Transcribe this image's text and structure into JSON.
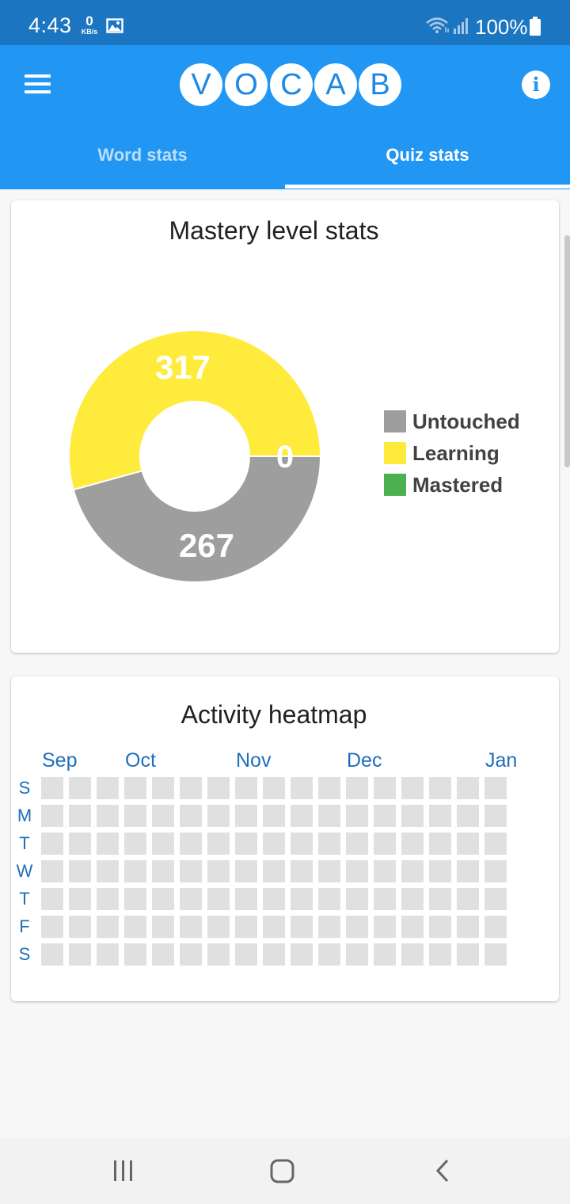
{
  "status_bar": {
    "time": "4:43",
    "net_speed_value": "0",
    "net_speed_unit": "KB/s",
    "battery_percent": "100%",
    "icons": [
      "image-icon",
      "wifi-icon",
      "signal-icon",
      "battery-icon"
    ]
  },
  "app_bar": {
    "logo_letters": [
      "V",
      "O",
      "C",
      "A",
      "B"
    ],
    "menu_icon": "hamburger-menu-icon",
    "info_icon": "info-icon",
    "info_label": "i",
    "colors": {
      "primary": "#2196f3",
      "status_bar": "#1b75c0",
      "logo_text": "#1e88e5"
    }
  },
  "tabs": [
    {
      "label": "Word stats",
      "selected": false
    },
    {
      "label": "Quiz stats",
      "selected": true
    }
  ],
  "mastery": {
    "title": "Mastery level stats",
    "chart_data": {
      "type": "pie",
      "donut": true,
      "categories": [
        "Untouched",
        "Learning",
        "Mastered"
      ],
      "values": [
        267,
        317,
        0
      ],
      "colors": [
        "#9e9e9e",
        "#ffeb3b",
        "#4caf50"
      ],
      "legend_position": "right"
    },
    "labels": {
      "untouched": "267",
      "learning": "317",
      "mastered": "0"
    },
    "legend": [
      {
        "label": "Untouched",
        "color": "#9e9e9e"
      },
      {
        "label": "Learning",
        "color": "#ffeb3b"
      },
      {
        "label": "Mastered",
        "color": "#4caf50"
      }
    ]
  },
  "heatmap": {
    "title": "Activity heatmap",
    "months": [
      "Sep",
      "Oct",
      "Nov",
      "Dec",
      "Jan"
    ],
    "days": [
      "S",
      "M",
      "T",
      "W",
      "T",
      "F",
      "S"
    ],
    "weeks": 17,
    "empty_color": "#e0e0e0",
    "label_color": "#1e6fba"
  },
  "nav_bar": {
    "icons": [
      "recent-apps-icon",
      "home-icon",
      "back-icon"
    ]
  }
}
